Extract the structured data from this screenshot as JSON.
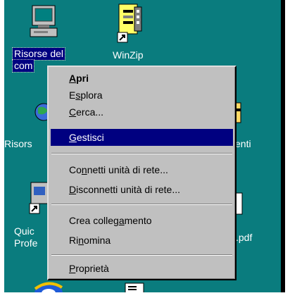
{
  "desktop": {
    "icons": [
      {
        "name": "my-computer",
        "label_line1": "Risorse del",
        "label_line2": "com"
      },
      {
        "name": "winzip",
        "label": "WinZip"
      },
      {
        "name": "network",
        "label": "Risors"
      },
      {
        "name": "documents",
        "label": "enti"
      },
      {
        "name": "quick",
        "label_line1": "Quic",
        "label_line2": "Profe"
      },
      {
        "name": "pdf",
        "label": ".pdf"
      }
    ]
  },
  "menu": {
    "items": [
      {
        "pre": "",
        "u": "A",
        "post": "pri",
        "bold": true
      },
      {
        "pre": "E",
        "u": "s",
        "post": "plora"
      },
      {
        "pre": "",
        "u": "C",
        "post": "erca..."
      },
      {
        "pre": "",
        "u": "G",
        "post": "estisci",
        "highlighted": true
      },
      {
        "pre": "Co",
        "u": "n",
        "post": "netti unità di rete..."
      },
      {
        "pre": "",
        "u": "D",
        "post": "isconnetti unità di rete..."
      },
      {
        "pre": "Crea colleg",
        "u": "a",
        "post": "mento"
      },
      {
        "pre": "Ri",
        "u": "n",
        "post": "omina"
      },
      {
        "pre": "",
        "u": "P",
        "post": "roprietà"
      }
    ]
  }
}
